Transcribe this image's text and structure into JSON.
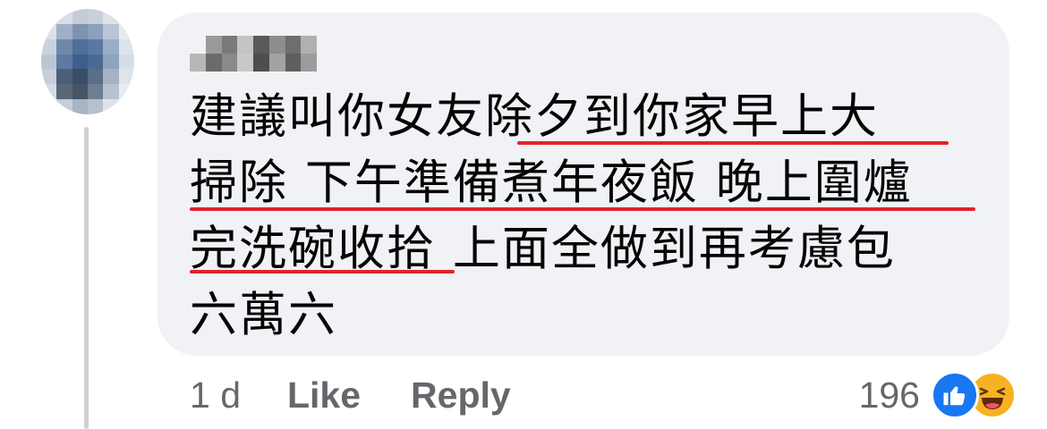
{
  "comment": {
    "author": "",
    "lines": [
      "建議叫你女友除夕到你家早上大",
      "掃除 下午準備煮年夜飯 晚上圍爐",
      "完洗碗收拾 上面全做到再考慮包",
      "六萬六"
    ],
    "timestamp": "1 d",
    "like_label": "Like",
    "reply_label": "Reply",
    "reaction_count": "196",
    "reactions": [
      "like-icon",
      "haha-icon"
    ]
  },
  "colors": {
    "bubble": "#f0f2f5",
    "text": "#050505",
    "meta": "#65676b",
    "underline": "#e0232c",
    "like": "#1877f2",
    "haha": "#f7b125",
    "thread_line": "#ced0d4"
  }
}
